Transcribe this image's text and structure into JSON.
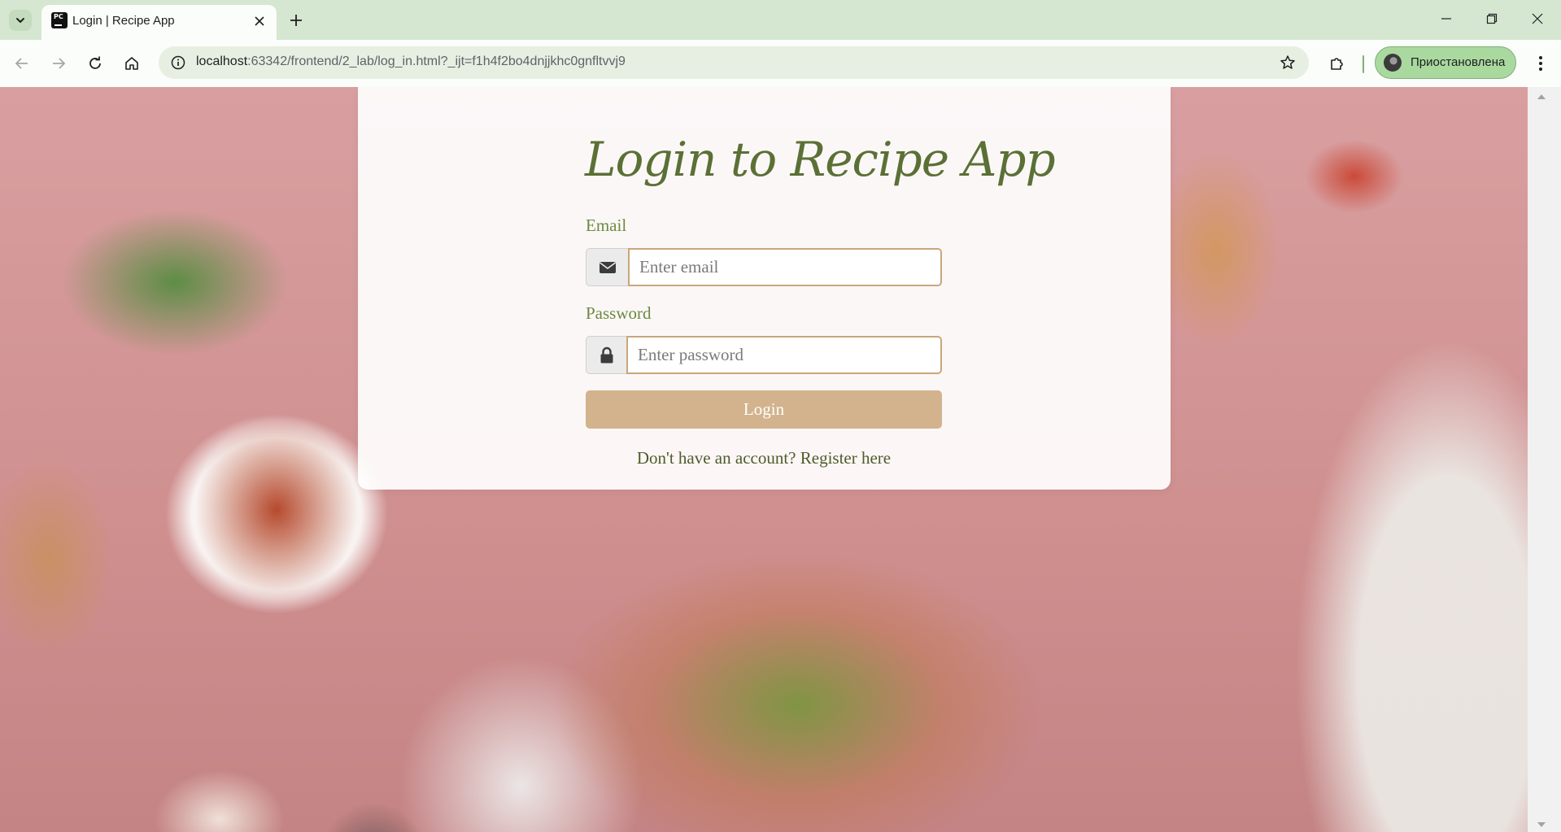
{
  "browser": {
    "tab": {
      "title": "Login | Recipe App",
      "favicon_text": "PC"
    },
    "url": {
      "host": "localhost",
      "rest": ":63342/frontend/2_lab/log_in.html?_ijt=f1h4f2bo4dnjjkhc0gnfltvvj9"
    },
    "profile": {
      "label": "Приостановлена"
    },
    "colors": {
      "frame": "#d5e6d1",
      "profile_chip": "#a9d99f"
    }
  },
  "login": {
    "title": "Login to Recipe App",
    "email_label": "Email",
    "email_placeholder": "Enter email",
    "password_label": "Password",
    "password_placeholder": "Enter password",
    "submit_label": "Login",
    "register_prefix": "Don't have an account? ",
    "register_link": "Register here",
    "colors": {
      "title": "#5b7035",
      "label": "#6a8a3e",
      "button": "#d3b38d",
      "input_border": "#c9a77b"
    }
  },
  "icons": {
    "tab_search": "chevron-down-icon",
    "close_tab": "close-icon",
    "new_tab": "plus-icon",
    "back": "arrow-left-icon",
    "forward": "arrow-right-icon",
    "reload": "reload-icon",
    "home": "home-icon",
    "site_info": "info-icon",
    "bookmark": "star-icon",
    "extensions": "puzzle-icon",
    "menu": "kebab-menu-icon",
    "email": "envelope-icon",
    "password": "lock-icon"
  }
}
